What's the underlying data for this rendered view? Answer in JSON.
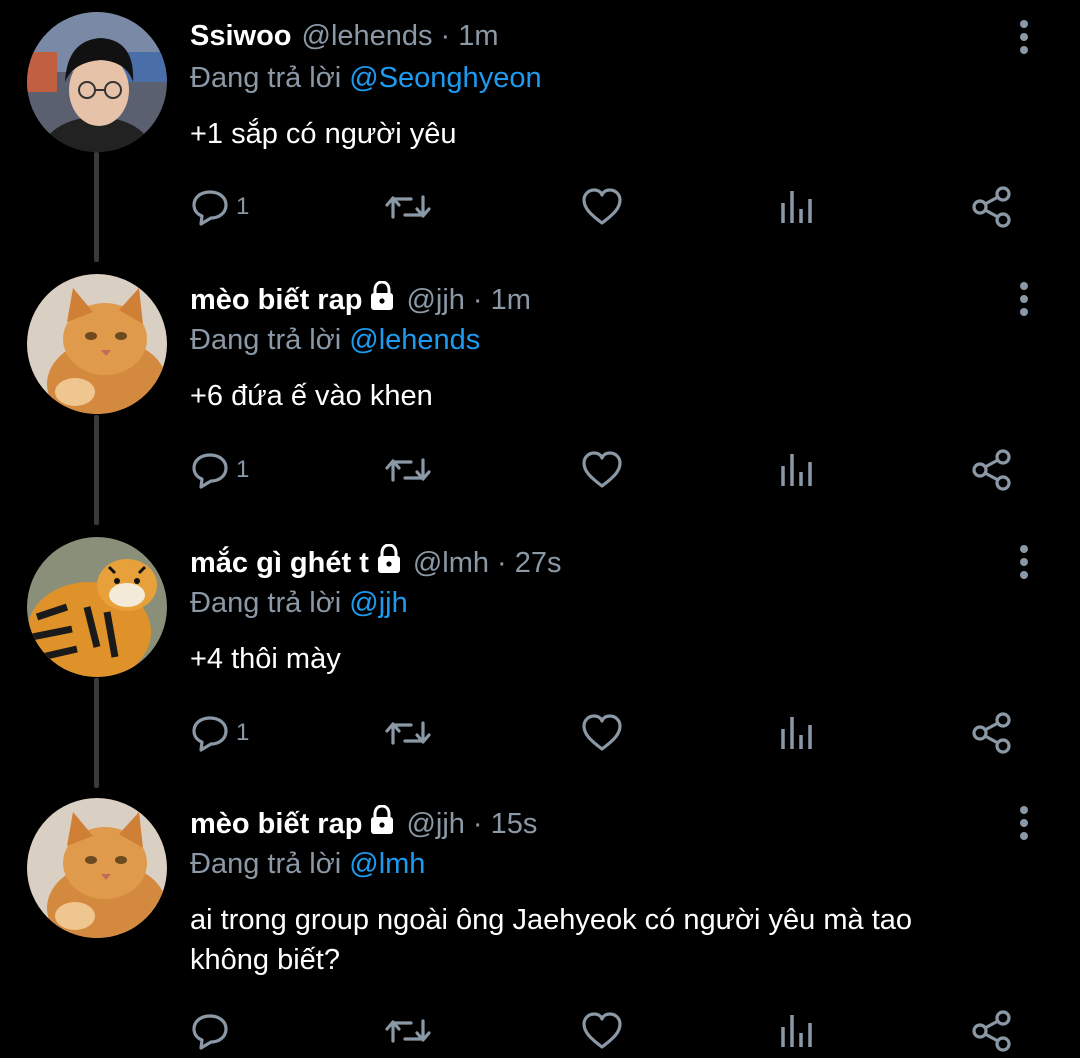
{
  "tweets": [
    {
      "name": "Ssiwoo",
      "locked": false,
      "handle": "@lehends",
      "dot": "·",
      "time": "1m",
      "replying_prefix": "Đang trả lời",
      "replying_to": "@Seonghyeon",
      "text": "+1 sắp có người yêu",
      "reply_count": "1",
      "avatar": "person-with-glasses"
    },
    {
      "name": "mèo biết rap",
      "locked": true,
      "handle": "@jjh",
      "dot": "·",
      "time": "1m",
      "replying_prefix": "Đang trả lời",
      "replying_to": "@lehends",
      "text": "+6 đứa ế vào khen",
      "reply_count": "1",
      "avatar": "orange-cat"
    },
    {
      "name": "mắc gì ghét t",
      "locked": true,
      "handle": "@lmh",
      "dot": "·",
      "time": "27s",
      "replying_prefix": "Đang trả lời",
      "replying_to": "@jjh",
      "text": "+4 thôi mày",
      "reply_count": "1",
      "avatar": "tiger-plush"
    },
    {
      "name": "mèo biết rap",
      "locked": true,
      "handle": "@jjh",
      "dot": "·",
      "time": "15s",
      "replying_prefix": "Đang trả lời",
      "replying_to": "@lmh",
      "text_line1": "ai trong group ngoài ông Jaehyeok có người yêu mà tao",
      "text_line2": "không biết?",
      "reply_count": "",
      "avatar": "orange-cat"
    }
  ],
  "icons": [
    "reply-icon",
    "retweet-icon",
    "like-icon",
    "views-icon",
    "share-icon",
    "more-icon",
    "lock-icon"
  ],
  "colors": {
    "background": "#000000",
    "text": "#ffffff",
    "muted": "#8b98a5",
    "mention": "#1d9bf0",
    "thread": "#3a3a3a"
  }
}
